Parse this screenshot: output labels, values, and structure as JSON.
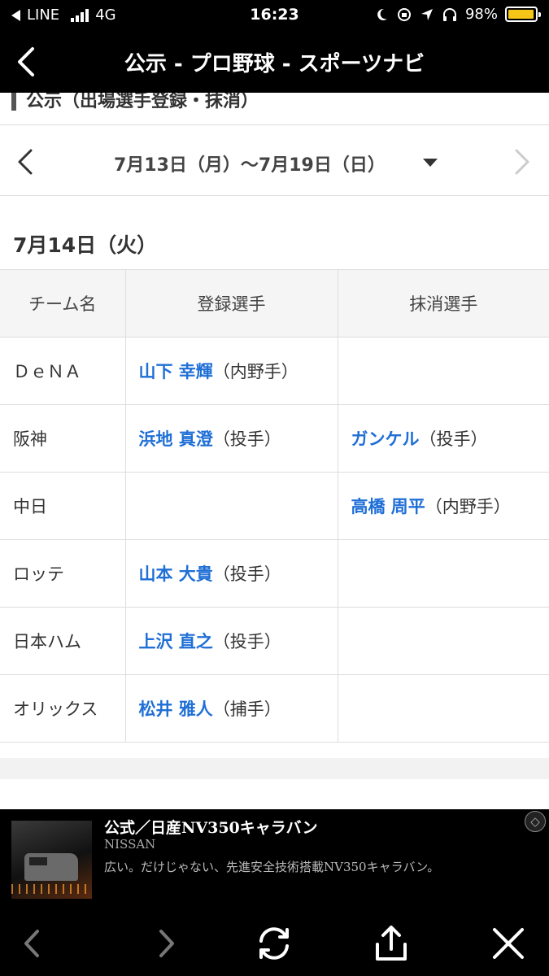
{
  "status_bar": {
    "back_app": "LINE",
    "network": "4G",
    "time": "16:23",
    "battery_percent": "98%",
    "battery_level": 0.98
  },
  "nav": {
    "title": "公示 - プロ野球 - スポーツナビ"
  },
  "section": {
    "title": "公示（出場選手登録・抹消）"
  },
  "week": {
    "label": "7月13日（月）〜7月19日（日）"
  },
  "day": {
    "heading": "7月14日（火）"
  },
  "table": {
    "headers": [
      "チーム名",
      "登録選手",
      "抹消選手"
    ],
    "rows": [
      {
        "team": "ＤｅＮＡ",
        "registered_name": "山下 幸輝",
        "registered_pos": "（内野手）",
        "removed_name": "",
        "removed_pos": ""
      },
      {
        "team": "阪神",
        "registered_name": "浜地 真澄",
        "registered_pos": "（投手）",
        "removed_name": "ガンケル",
        "removed_pos": "（投手）"
      },
      {
        "team": "中日",
        "registered_name": "",
        "registered_pos": "",
        "removed_name": "高橋 周平",
        "removed_pos": "（内野手）"
      },
      {
        "team": "ロッテ",
        "registered_name": "山本 大貴",
        "registered_pos": "（投手）",
        "removed_name": "",
        "removed_pos": ""
      },
      {
        "team": "日本ハム",
        "registered_name": "上沢 直之",
        "registered_pos": "（投手）",
        "removed_name": "",
        "removed_pos": ""
      },
      {
        "team": "オリックス",
        "registered_name": "松井 雅人",
        "registered_pos": "（捕手）",
        "removed_name": "",
        "removed_pos": ""
      }
    ]
  },
  "ad": {
    "title": "公式／日産NV350キャラバン",
    "sponsor": "NISSAN",
    "description": "広い。だけじゃない、先進安全技術搭載NV350キャラバン。"
  },
  "colors": {
    "link": "#1f6fd6",
    "bar_bg": "#000000",
    "battery": "#f5c518"
  }
}
